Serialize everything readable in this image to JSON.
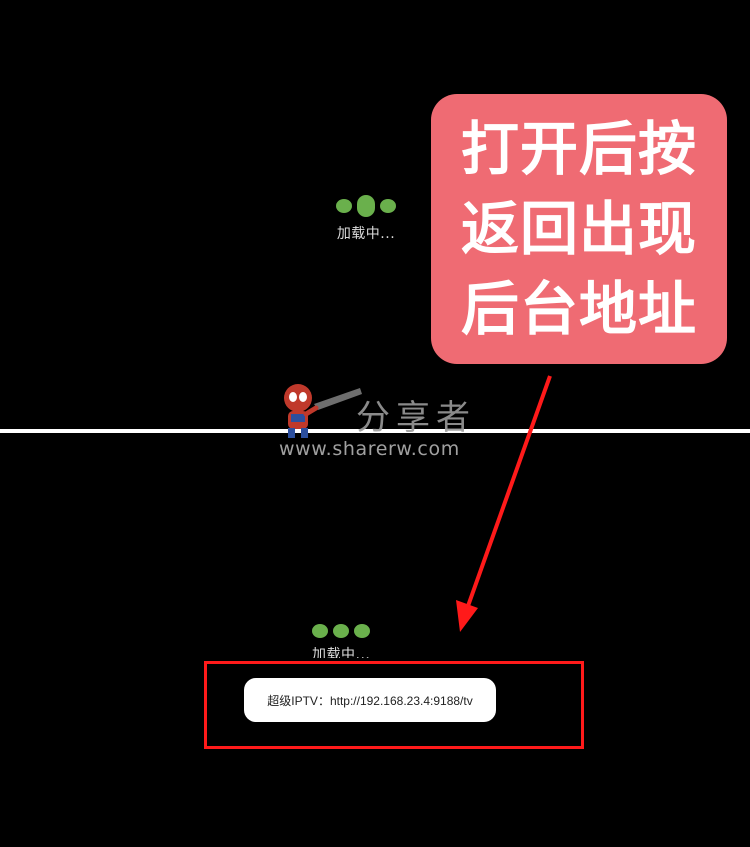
{
  "loaders": {
    "top_label": "加载中...",
    "bottom_label": "加载中..."
  },
  "callout": {
    "lines": [
      "打开后按",
      "返回出现",
      "后台地址"
    ],
    "bg_color": "#ef6b73"
  },
  "toast": {
    "text": "超级IPTV：http://192.168.23.4:9188/tv"
  },
  "watermark": {
    "site_cn": "分享者",
    "url": "www.sharerw.com"
  },
  "colors": {
    "background": "#000000",
    "dot_green": "#6ab04c",
    "annotation_red": "#ff1a1a"
  },
  "icons": {
    "loading": "loading-dots-icon",
    "arrow": "annotation-arrow-icon",
    "mascot": "spiderman-mascot-icon"
  }
}
